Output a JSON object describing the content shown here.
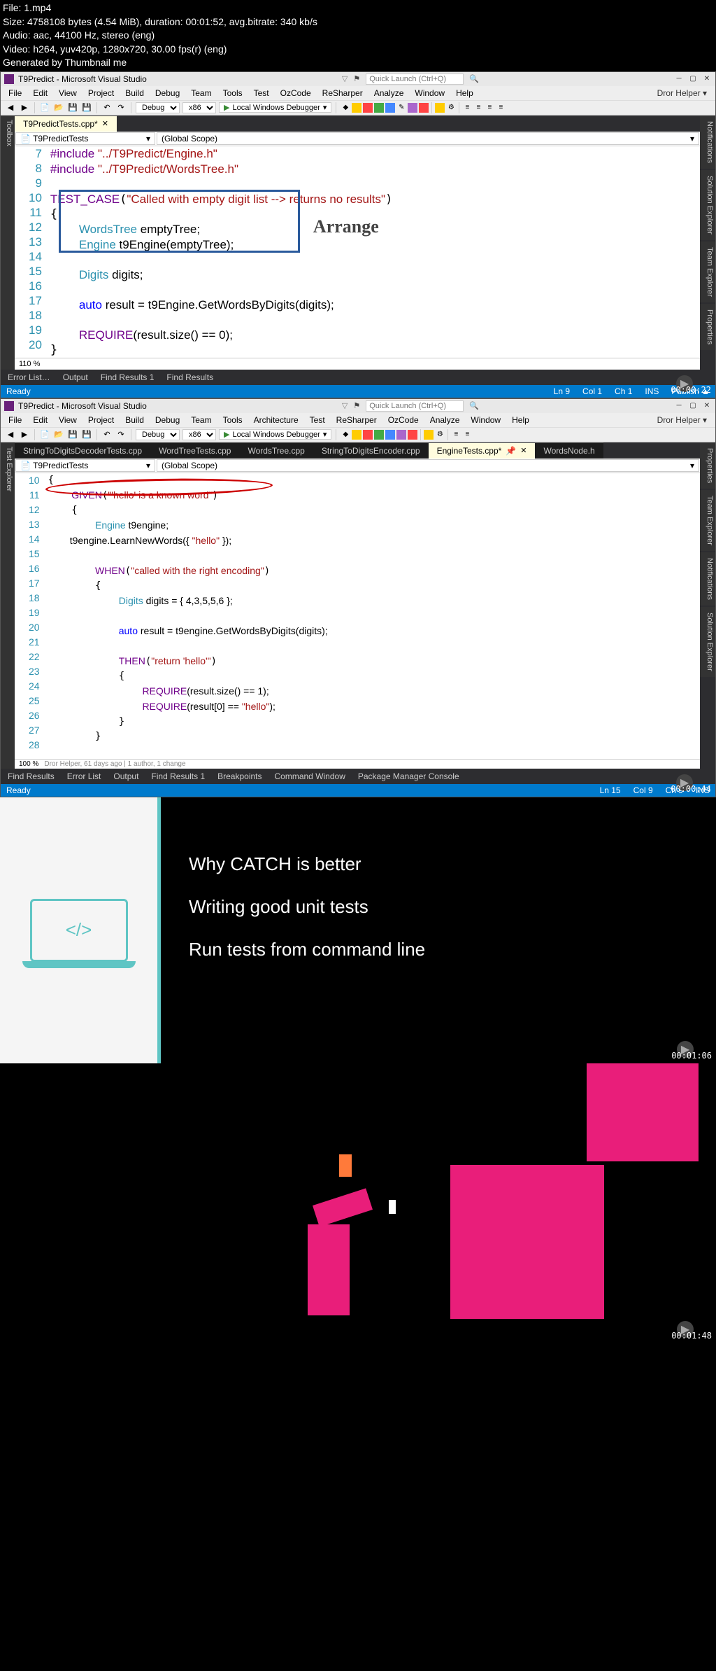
{
  "meta": {
    "file": "File: 1.mp4",
    "size": "Size: 4758108 bytes (4.54 MiB), duration: 00:01:52, avg.bitrate: 340 kb/s",
    "audio": "Audio: aac, 44100 Hz, stereo (eng)",
    "video": "Video: h264, yuv420p, 1280x720, 30.00 fps(r) (eng)",
    "gen": "Generated by Thumbnail me"
  },
  "vs1": {
    "title": "T9Predict - Microsoft Visual Studio",
    "menus": [
      "File",
      "Edit",
      "View",
      "Project",
      "Build",
      "Debug",
      "Team",
      "Tools",
      "Test",
      "OzCode",
      "ReSharper",
      "Analyze",
      "Window",
      "Help"
    ],
    "user": "Dror Helper",
    "ql_placeholder": "Quick Launch (Ctrl+Q)",
    "config": "Debug",
    "platform": "x86",
    "debugger": "Local Windows Debugger",
    "tab_active": "T9PredictTests.cpp*",
    "scope_left": "T9PredictTests",
    "scope_right": "(Global Scope)",
    "left_rail": "Toolbox",
    "side_tabs": [
      "Notifications",
      "Solution Explorer",
      "Team Explorer",
      "Properties"
    ],
    "line_numbers": [
      "7",
      "8",
      "9",
      "10",
      "11",
      "12",
      "13",
      "14",
      "15",
      "16",
      "17",
      "18",
      "19",
      "20"
    ],
    "code": {
      "l7_pre": "#include ",
      "l7_str": "\"../T9Predict/Engine.h\"",
      "l8_pre": "#include ",
      "l8_str": "\"../T9Predict/WordsTree.h\"",
      "l10_macro": "TEST_CASE",
      "l10_str": "\"Called with empty digit list --> returns no results\"",
      "l11": "{",
      "l12_type": "WordsTree",
      "l12_rest": " emptyTree;",
      "l13_type": "Engine",
      "l13_rest": " t9Engine(emptyTree);",
      "l15_type": "Digits",
      "l15_rest": " digits;",
      "l17_kw": "auto",
      "l17_rest": " result = t9Engine.GetWordsByDigits(digits);",
      "l19_macro": "REQUIRE",
      "l19_rest": "(result.size() == 0);",
      "l20": "}"
    },
    "arrange": "Arrange",
    "zoom": "110 %",
    "bottom_tabs": [
      "Error List…",
      "Output",
      "Find Results 1",
      "Find Results"
    ],
    "status": {
      "ready": "Ready",
      "ln": "Ln 9",
      "col": "Col 1",
      "ch": "Ch 1",
      "ins": "INS",
      "publish": "Publish ▲"
    },
    "timestamp": "00:00:22"
  },
  "vs2": {
    "title": "T9Predict - Microsoft Visual Studio",
    "menus": [
      "File",
      "Edit",
      "View",
      "Project",
      "Build",
      "Debug",
      "Team",
      "Tools",
      "Architecture",
      "Test",
      "ReSharper",
      "OzCode",
      "Analyze",
      "Window",
      "Help"
    ],
    "user": "Dror Helper",
    "ql_placeholder": "Quick Launch (Ctrl+Q)",
    "config": "Debug",
    "platform": "x86",
    "debugger": "Local Windows Debugger",
    "tabs": [
      "StringToDigitsDecoderTests.cpp",
      "WordTreeTests.cpp",
      "WordsTree.cpp",
      "StringToDigitsEncoder.cpp"
    ],
    "tab_active": "EngineTests.cpp*",
    "tab_after": "WordsNode.h",
    "scope_left": "T9PredictTests",
    "scope_right": "(Global Scope)",
    "left_rail": "Test Explorer",
    "side_tabs": [
      "Properties",
      "Team Explorer",
      "Notifications",
      "Solution Explorer"
    ],
    "line_numbers": [
      "10",
      "11",
      "12",
      "13",
      "14",
      "15",
      "16",
      "17",
      "18",
      "19",
      "20",
      "21",
      "22",
      "23",
      "24",
      "25",
      "26",
      "27",
      "28"
    ],
    "code": {
      "l10": "{",
      "l11_macro": "GIVEN",
      "l11_str": "\"'hello' is a known word\"",
      "l12": "    {",
      "l13_type": "Engine",
      "l13_rest": " t9engine;",
      "l14_rest": "        t9engine.LearnNewWords({ ",
      "l14_str": "\"hello\"",
      "l14_end": " });",
      "l16_macro": "WHEN",
      "l16_str": "\"called with the right encoding\"",
      "l17": "        {",
      "l18_type": "Digits",
      "l18_rest": " digits = { 4,3,5,5,6 };",
      "l20_kw": "auto",
      "l20_rest": " result = t9engine.GetWordsByDigits(digits);",
      "l22_macro": "THEN",
      "l22_str": "\"return 'hello'\"",
      "l23": "            {",
      "l24_macro": "REQUIRE",
      "l24_rest": "(result.size() == 1);",
      "l25_macro": "REQUIRE",
      "l25_mid": "(result[0] == ",
      "l25_str": "\"hello\"",
      "l25_end": ");",
      "l26": "            }",
      "l27": "        }"
    },
    "zoom": "100 %",
    "blame": "Dror Helper, 61 days ago | 1 author, 1 change",
    "bottom_tabs": [
      "Find Results",
      "Error List",
      "Output",
      "Find Results 1",
      "Breakpoints",
      "Command Window",
      "Package Manager Console"
    ],
    "status": {
      "ready": "Ready",
      "ln": "Ln 15",
      "col": "Col 9",
      "ch": "Ch 9",
      "ins": "INS"
    },
    "timestamp": "00:00:44"
  },
  "slide": {
    "bullets": [
      "Why CATCH is better",
      "Writing good unit tests",
      "Run tests from command line"
    ],
    "code_icon": "</>",
    "timestamp": "00:01:06"
  },
  "frame4": {
    "timestamp": "00:01:48"
  }
}
